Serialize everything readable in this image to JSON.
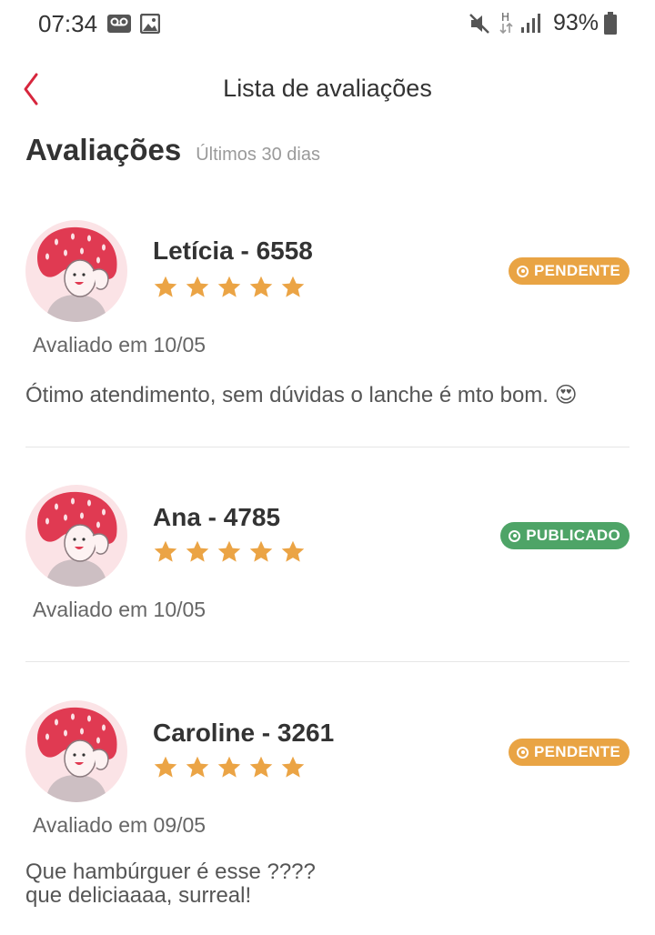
{
  "status_bar": {
    "time": "07:34",
    "battery": "93%",
    "icons": [
      "voicemail-icon",
      "image-icon",
      "mute-icon",
      "network-h-icon",
      "signal-icon",
      "battery-icon"
    ]
  },
  "topbar": {
    "back_icon": "chevron-left-icon",
    "title": "Lista de avaliações"
  },
  "section": {
    "title": "Avaliações",
    "subtitle": "Últimos 30 dias"
  },
  "colors": {
    "accent": "#d7263d",
    "star": "#eba445",
    "pending": "#e9a444",
    "published": "#4ea467"
  },
  "reviews": [
    {
      "name": "Letícia - 6558",
      "rating": 5,
      "status": "PENDENTE",
      "date": "Avaliado em 10/05",
      "comment": "Ótimo atendimento, sem dúvidas o lanche é mto bom. 😍"
    },
    {
      "name": "Ana - 4785",
      "rating": 5,
      "status": "PUBLICADO",
      "date": "Avaliado em 10/05",
      "comment": ""
    },
    {
      "name": "Caroline - 3261",
      "rating": 5,
      "status": "PENDENTE",
      "date": "Avaliado em 09/05",
      "comment": "Que hambúrguer é esse ????\nque deliciaaaa, surreal!"
    }
  ]
}
